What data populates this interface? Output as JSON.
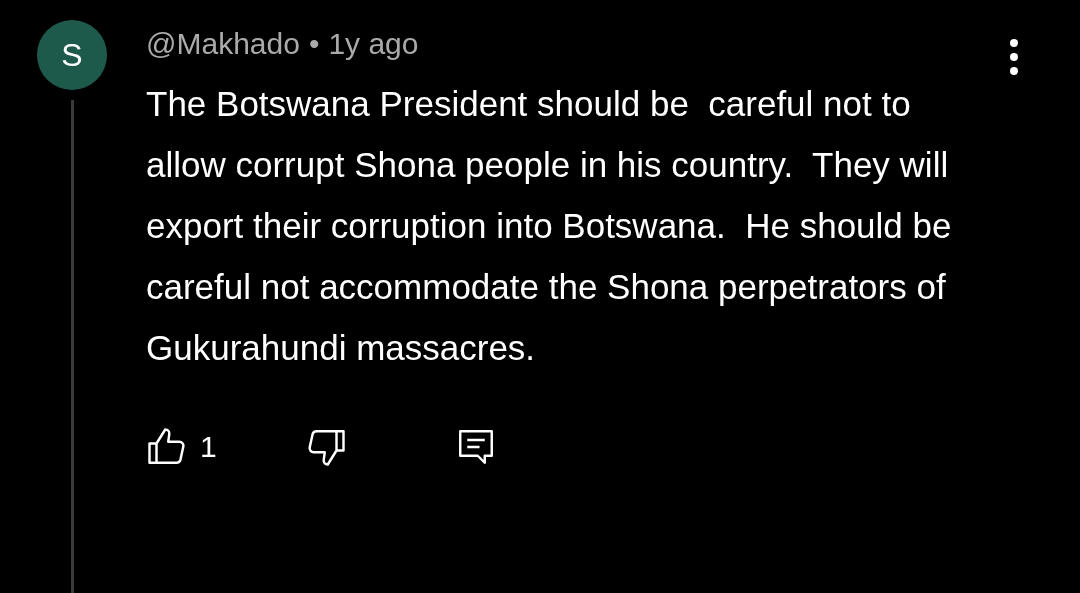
{
  "comment": {
    "avatar_letter": "S",
    "author": "@Makhado",
    "separator": "•",
    "time": "1y ago",
    "text": "The Botswana President should be  careful not to allow corrupt Shona people in his country.  They will export their corruption into Botswana.  He should be careful not accommodate the Shona perpetrators of Gukurahundi massacres.",
    "like_count": "1"
  }
}
